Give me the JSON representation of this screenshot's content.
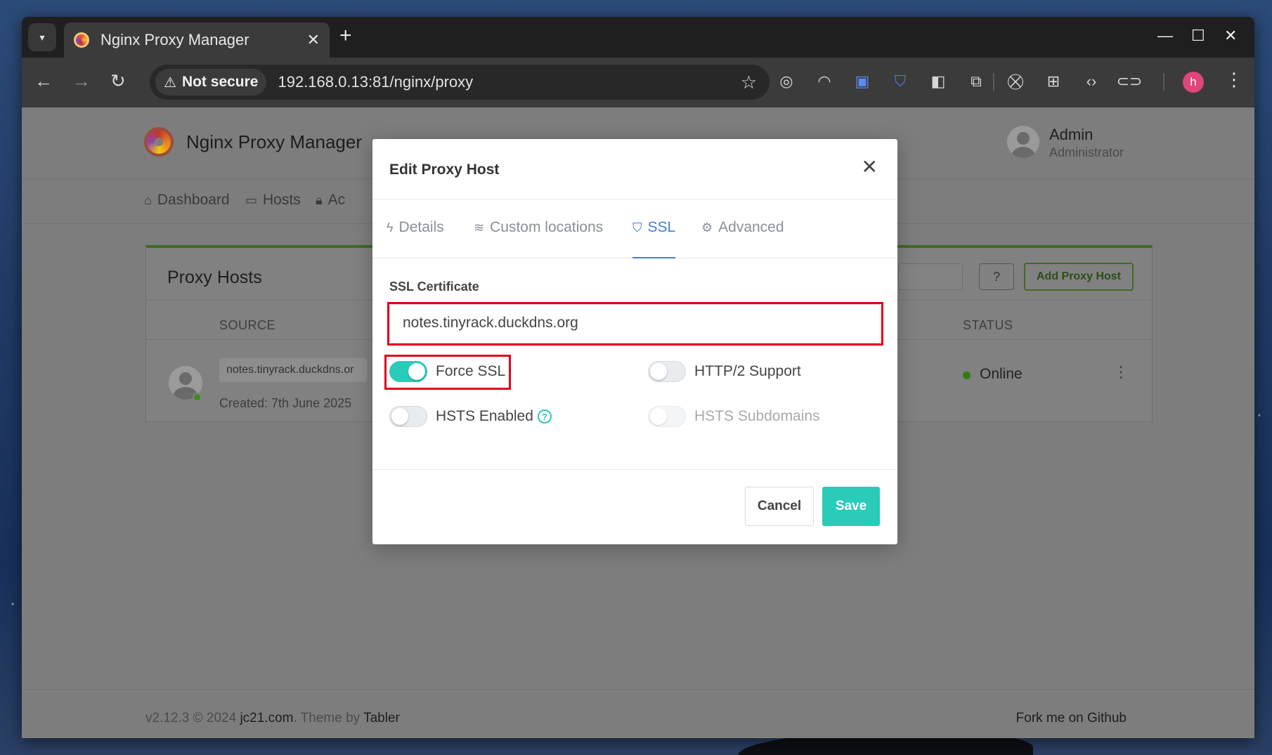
{
  "browser": {
    "tab_title": "Nginx Proxy Manager",
    "security_label": "Not secure",
    "url": "192.168.0.13:81/nginx/proxy",
    "profile_initial": "h"
  },
  "app": {
    "brand": "Nginx Proxy Manager",
    "user_name": "Admin",
    "user_role": "Administrator",
    "nav": {
      "dashboard": "Dashboard",
      "hosts": "Hosts",
      "access": "Ac"
    },
    "card": {
      "title": "Proxy Hosts",
      "add_button": "Add Proxy Host",
      "columns": {
        "source": "SOURCE",
        "status": "STATUS"
      },
      "row": {
        "domain": "notes.tinyrack.duckdns.or",
        "created": "Created: 7th June 2025",
        "status": "Online"
      }
    },
    "footer": {
      "version": "v2.12.3 © 2024",
      "site": "jc21.com",
      "theme_by": ". Theme by",
      "theme": "Tabler",
      "github": "Fork me on Github"
    }
  },
  "modal": {
    "title": "Edit Proxy Host",
    "tabs": {
      "details": "Details",
      "custom_locations": "Custom locations",
      "ssl": "SSL",
      "advanced": "Advanced"
    },
    "active_tab": "SSL",
    "ssl_label": "SSL Certificate",
    "ssl_value": "notes.tinyrack.duckdns.org",
    "toggles": {
      "force_ssl": {
        "label": "Force SSL",
        "on": true
      },
      "http2": {
        "label": "HTTP/2 Support",
        "on": false
      },
      "hsts": {
        "label": "HSTS Enabled",
        "on": false
      },
      "hsts_sub": {
        "label": "HSTS Subdomains",
        "on": false,
        "disabled": true
      }
    },
    "cancel_label": "Cancel",
    "save_label": "Save"
  },
  "colors": {
    "accent": "#2bcbba",
    "tab_active": "#467fcf",
    "highlight": "#e0001b",
    "online": "#2e7d12"
  }
}
